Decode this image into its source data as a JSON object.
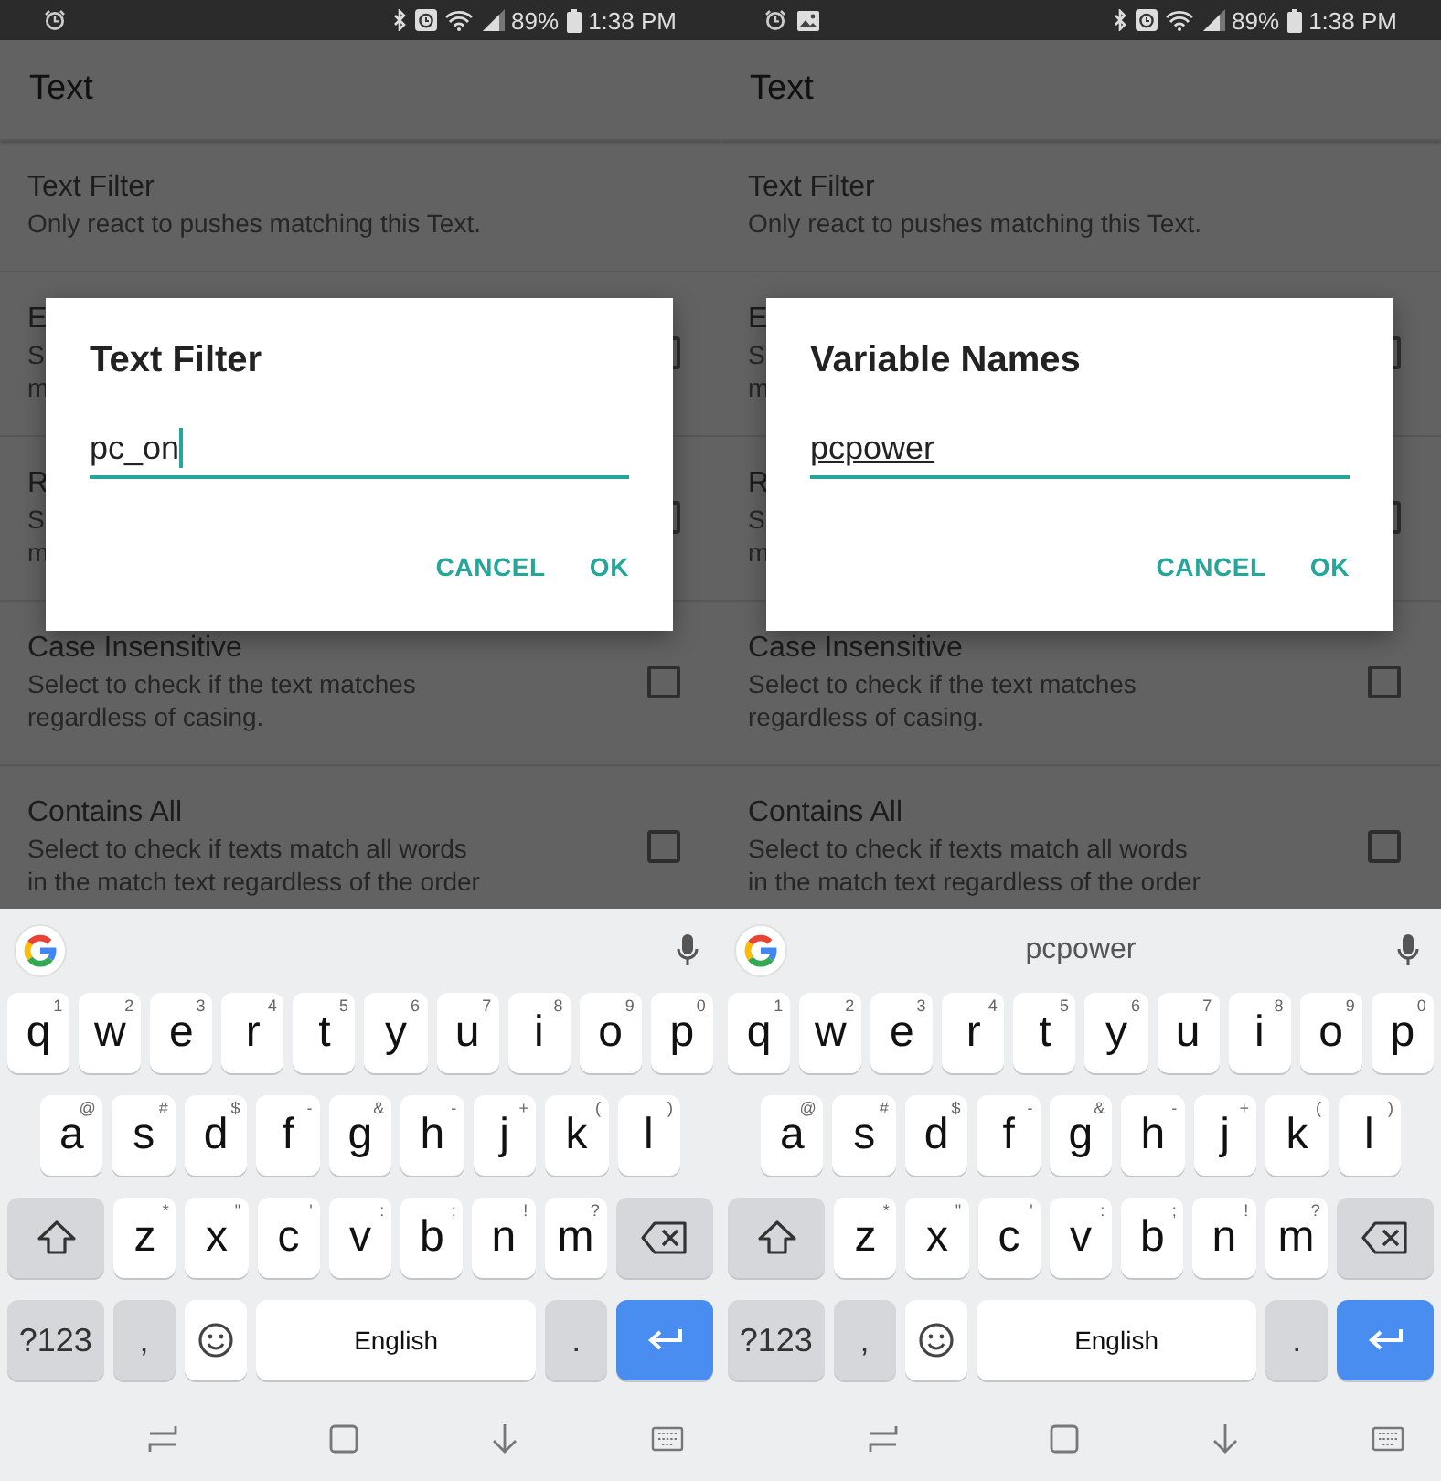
{
  "phones": [
    {
      "status_bar": {
        "notifications": [
          {
            "kind": "alarm"
          }
        ],
        "battery": "89%",
        "time": "1:38 PM"
      },
      "app_bar": {
        "title": "Text"
      },
      "settings": [
        {
          "title": "Text Filter",
          "description": [
            "Only react to pushes matching this Text."
          ]
        },
        {
          "title": "E",
          "description": [
            "S",
            "m"
          ],
          "checked": false
        },
        {
          "title": "R",
          "description": [
            "S",
            "m"
          ],
          "checked": false
        },
        {
          "title": "Case Insensitive",
          "description": [
            "Select to check if the text matches",
            "regardless of casing."
          ],
          "checked": false
        },
        {
          "title": "Contains All",
          "description": [
            "Select to check if texts match all words",
            "in the match text regardless of the order"
          ],
          "checked": false
        }
      ],
      "dialog": {
        "title": "Text Filter",
        "value": "pc_on",
        "cursor": true,
        "composing": false,
        "buttons": [
          "CANCEL",
          "OK"
        ]
      },
      "keyboard": {
        "key_rows": [
          {
            "keys": [
              {
                "kind": "letter",
                "label": "q",
                "hint": "1"
              },
              {
                "kind": "letter",
                "label": "w",
                "hint": "2"
              },
              {
                "kind": "letter",
                "label": "e",
                "hint": "3"
              },
              {
                "kind": "letter",
                "label": "r",
                "hint": "4"
              },
              {
                "kind": "letter",
                "label": "t",
                "hint": "5"
              },
              {
                "kind": "letter",
                "label": "y",
                "hint": "6"
              },
              {
                "kind": "letter",
                "label": "u",
                "hint": "7"
              },
              {
                "kind": "letter",
                "label": "i",
                "hint": "8"
              },
              {
                "kind": "letter",
                "label": "o",
                "hint": "9"
              },
              {
                "kind": "letter",
                "label": "p",
                "hint": "0"
              }
            ]
          },
          {
            "keys": [
              {
                "kind": "letter",
                "label": "a",
                "hint": "@"
              },
              {
                "kind": "letter",
                "label": "s",
                "hint": "#"
              },
              {
                "kind": "letter",
                "label": "d",
                "hint": "$"
              },
              {
                "kind": "letter",
                "label": "f",
                "hint": "-"
              },
              {
                "kind": "letter",
                "label": "g",
                "hint": "&"
              },
              {
                "kind": "letter",
                "label": "h",
                "hint": "-"
              },
              {
                "kind": "letter",
                "label": "j",
                "hint": "+"
              },
              {
                "kind": "letter",
                "label": "k",
                "hint": "("
              },
              {
                "kind": "letter",
                "label": "l",
                "hint": ")"
              }
            ]
          },
          {
            "keys": [
              {
                "kind": "shift"
              },
              {
                "kind": "letter",
                "label": "z",
                "hint": "*"
              },
              {
                "kind": "letter",
                "label": "x",
                "hint": "\""
              },
              {
                "kind": "letter",
                "label": "c",
                "hint": "'"
              },
              {
                "kind": "letter",
                "label": "v",
                "hint": ":"
              },
              {
                "kind": "letter",
                "label": "b",
                "hint": ";"
              },
              {
                "kind": "letter",
                "label": "n",
                "hint": "!"
              },
              {
                "kind": "letter",
                "label": "m",
                "hint": "?"
              },
              {
                "kind": "backspace"
              }
            ]
          },
          {
            "keys": [
              {
                "kind": "symbols",
                "label": "?123"
              },
              {
                "kind": "comma",
                "label": ","
              },
              {
                "kind": "emoji"
              },
              {
                "kind": "space",
                "label": "English"
              },
              {
                "kind": "period",
                "label": "."
              },
              {
                "kind": "enter"
              }
            ]
          }
        ]
      }
    },
    {
      "status_bar": {
        "notifications": [
          {
            "kind": "alarm"
          },
          {
            "kind": "picture"
          }
        ],
        "battery": "89%",
        "time": "1:38 PM"
      },
      "app_bar": {
        "title": "Text"
      },
      "settings": [
        {
          "title": "Text Filter",
          "description": [
            "Only react to pushes matching this Text."
          ]
        },
        {
          "title": "E",
          "description": [
            "S",
            "m"
          ],
          "checked": false
        },
        {
          "title": "R",
          "description": [
            "S",
            "m"
          ],
          "checked": false
        },
        {
          "title": "Case Insensitive",
          "description": [
            "Select to check if the text matches",
            "regardless of casing."
          ],
          "checked": false
        },
        {
          "title": "Contains All",
          "description": [
            "Select to check if texts match all words",
            "in the match text regardless of the order"
          ],
          "checked": false
        }
      ],
      "dialog": {
        "title": "Variable Names",
        "value": "pcpower",
        "cursor": false,
        "composing": true,
        "buttons": [
          "CANCEL",
          "OK"
        ]
      },
      "keyboard": {
        "suggestion": "pcpower",
        "key_rows": [
          {
            "keys": [
              {
                "kind": "letter",
                "label": "q",
                "hint": "1"
              },
              {
                "kind": "letter",
                "label": "w",
                "hint": "2"
              },
              {
                "kind": "letter",
                "label": "e",
                "hint": "3"
              },
              {
                "kind": "letter",
                "label": "r",
                "hint": "4"
              },
              {
                "kind": "letter",
                "label": "t",
                "hint": "5"
              },
              {
                "kind": "letter",
                "label": "y",
                "hint": "6"
              },
              {
                "kind": "letter",
                "label": "u",
                "hint": "7"
              },
              {
                "kind": "letter",
                "label": "i",
                "hint": "8"
              },
              {
                "kind": "letter",
                "label": "o",
                "hint": "9"
              },
              {
                "kind": "letter",
                "label": "p",
                "hint": "0"
              }
            ]
          },
          {
            "keys": [
              {
                "kind": "letter",
                "label": "a",
                "hint": "@"
              },
              {
                "kind": "letter",
                "label": "s",
                "hint": "#"
              },
              {
                "kind": "letter",
                "label": "d",
                "hint": "$"
              },
              {
                "kind": "letter",
                "label": "f",
                "hint": "-"
              },
              {
                "kind": "letter",
                "label": "g",
                "hint": "&"
              },
              {
                "kind": "letter",
                "label": "h",
                "hint": "-"
              },
              {
                "kind": "letter",
                "label": "j",
                "hint": "+"
              },
              {
                "kind": "letter",
                "label": "k",
                "hint": "("
              },
              {
                "kind": "letter",
                "label": "l",
                "hint": ")"
              }
            ]
          },
          {
            "keys": [
              {
                "kind": "shift"
              },
              {
                "kind": "letter",
                "label": "z",
                "hint": "*"
              },
              {
                "kind": "letter",
                "label": "x",
                "hint": "\""
              },
              {
                "kind": "letter",
                "label": "c",
                "hint": "'"
              },
              {
                "kind": "letter",
                "label": "v",
                "hint": ":"
              },
              {
                "kind": "letter",
                "label": "b",
                "hint": ";"
              },
              {
                "kind": "letter",
                "label": "n",
                "hint": "!"
              },
              {
                "kind": "letter",
                "label": "m",
                "hint": "?"
              },
              {
                "kind": "backspace"
              }
            ]
          },
          {
            "keys": [
              {
                "kind": "symbols",
                "label": "?123"
              },
              {
                "kind": "comma",
                "label": ","
              },
              {
                "kind": "emoji"
              },
              {
                "kind": "space",
                "label": "English"
              },
              {
                "kind": "period",
                "label": "."
              },
              {
                "kind": "enter"
              }
            ]
          }
        ]
      }
    }
  ]
}
